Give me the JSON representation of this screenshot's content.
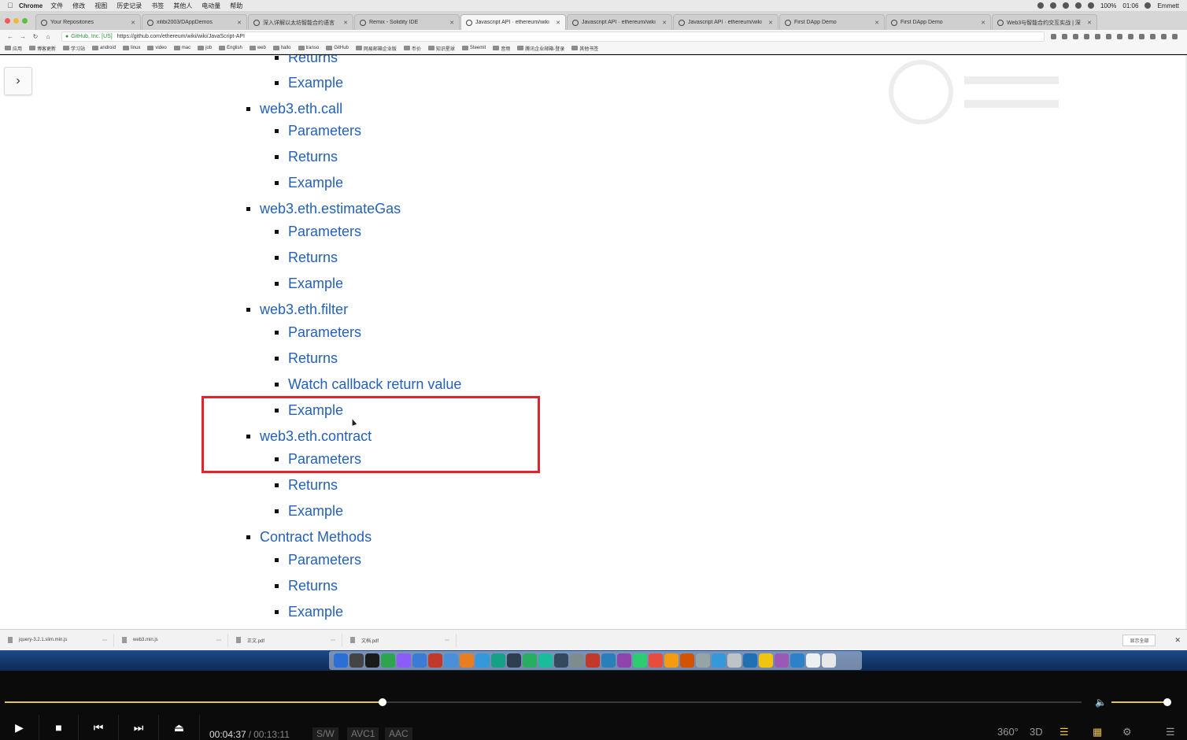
{
  "menubar": {
    "app_name": "Chrome",
    "items": [
      "文件",
      "修改",
      "视图",
      "历史记录",
      "书签",
      "其他人",
      "电动量",
      "帮助"
    ],
    "clock": "01:06",
    "battery": "100%",
    "user": "Emmett"
  },
  "tabs": [
    {
      "title": "Your Repositories",
      "active": false
    },
    {
      "title": "xilibi2003/DAppDemos",
      "active": false
    },
    {
      "title": "深入详解以太坊智能合约语言",
      "active": false
    },
    {
      "title": "Remix - Solidity IDE",
      "active": false
    },
    {
      "title": "Javascript API · ethereum/wiki",
      "active": true
    },
    {
      "title": "Javascript API · ethereum/wiki",
      "active": false
    },
    {
      "title": "Javascript API · ethereum/wiki",
      "active": false
    },
    {
      "title": "First DApp Demo",
      "active": false
    },
    {
      "title": "First DApp Demo",
      "active": false
    },
    {
      "title": "Web3与智能合约交互实战 | 深",
      "active": false
    }
  ],
  "address": {
    "org": "GitHub, Inc. [US]",
    "url": "https://github.com/ethereum/wiki/wiki/JavaScript-API"
  },
  "bookmarks": [
    "应用",
    "博客更新",
    "学习站",
    "android",
    "linux",
    "video",
    "mac",
    "job",
    "English",
    "web",
    "hallo",
    "transo",
    "GitHub",
    "网易邮箱企业版",
    "币价",
    "知识星球",
    "Steemit",
    "音频",
    "腾讯企业邮箱-登录",
    "其他书签"
  ],
  "toc": {
    "rows": [
      {
        "text": "Returns",
        "level": 2
      },
      {
        "text": "Example",
        "level": 2
      },
      {
        "text": "web3.eth.call",
        "level": 1
      },
      {
        "text": "Parameters",
        "level": 2
      },
      {
        "text": "Returns",
        "level": 2
      },
      {
        "text": "Example",
        "level": 2
      },
      {
        "text": "web3.eth.estimateGas",
        "level": 1
      },
      {
        "text": "Parameters",
        "level": 2
      },
      {
        "text": "Returns",
        "level": 2
      },
      {
        "text": "Example",
        "level": 2
      },
      {
        "text": "web3.eth.filter",
        "level": 1
      },
      {
        "text": "Parameters",
        "level": 2
      },
      {
        "text": "Returns",
        "level": 2
      },
      {
        "text": "Watch callback return value",
        "level": 2
      },
      {
        "text": "Example",
        "level": 2
      },
      {
        "text": "web3.eth.contract",
        "level": 1
      },
      {
        "text": "Parameters",
        "level": 2
      },
      {
        "text": "Returns",
        "level": 2
      },
      {
        "text": "Example",
        "level": 2
      },
      {
        "text": "Contract Methods",
        "level": 1
      },
      {
        "text": "Parameters",
        "level": 2
      },
      {
        "text": "Returns",
        "level": 2
      },
      {
        "text": "Example",
        "level": 2
      }
    ]
  },
  "downloads": [
    {
      "name": "jquery-3.2.1.slim.min.js"
    },
    {
      "name": "web3.min.js"
    },
    {
      "name": "正文.pdf"
    },
    {
      "name": "文档.pdf"
    }
  ],
  "downloads_show_all": "显示全部",
  "player": {
    "current_time": "00:04:37",
    "total_time": "00:13:11",
    "progress_fraction": 0.351,
    "volume_fraction": 0.93,
    "chips": [
      "S/W",
      "AVC1",
      "AAC"
    ],
    "labels": [
      "360°",
      "3D"
    ],
    "accent": "#e9c34a"
  },
  "highlight_color": "#e52229",
  "link_color": "#2461b8"
}
